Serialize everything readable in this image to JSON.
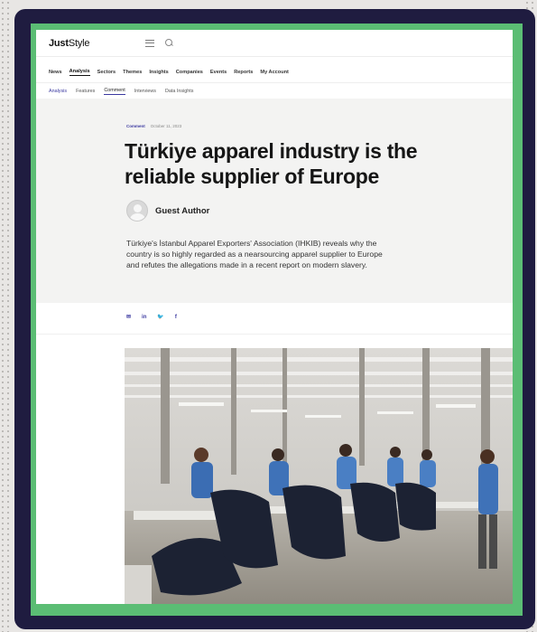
{
  "site": {
    "logo_bold": "Just",
    "logo_rest": "Style"
  },
  "main_nav": [
    "News",
    "Analysis",
    "Sectors",
    "Themes",
    "Insights",
    "Companies",
    "Events",
    "Reports",
    "My Account"
  ],
  "sub_nav": [
    "Analysis",
    "Features",
    "Comment",
    "Interviews",
    "Data Insights"
  ],
  "article": {
    "category": "Comment",
    "date": "October 11, 2023",
    "title_line1": "Türkiye apparel industry is the",
    "title_line2": "reliable supplier of Europe",
    "author": "Guest Author",
    "standfirst_line1": "Türkiye's İstanbul Apparel Exporters' Association (IHKIB) reveals why the",
    "standfirst_line2": "country is so highly regarded as a nearsourcing apparel supplier to Europe",
    "standfirst_line3": "and refutes the allegations made in a recent report on modern slavery."
  },
  "share": {
    "email": "✉",
    "linkedin": "in",
    "twitter": "🐦",
    "facebook": "f"
  },
  "colors": {
    "frame": "#1f1c40",
    "border": "#5bbd74",
    "accent": "#3b39a0"
  },
  "icons": [
    "menu-icon",
    "search-icon",
    "email-icon",
    "linkedin-icon",
    "twitter-icon",
    "facebook-icon"
  ]
}
